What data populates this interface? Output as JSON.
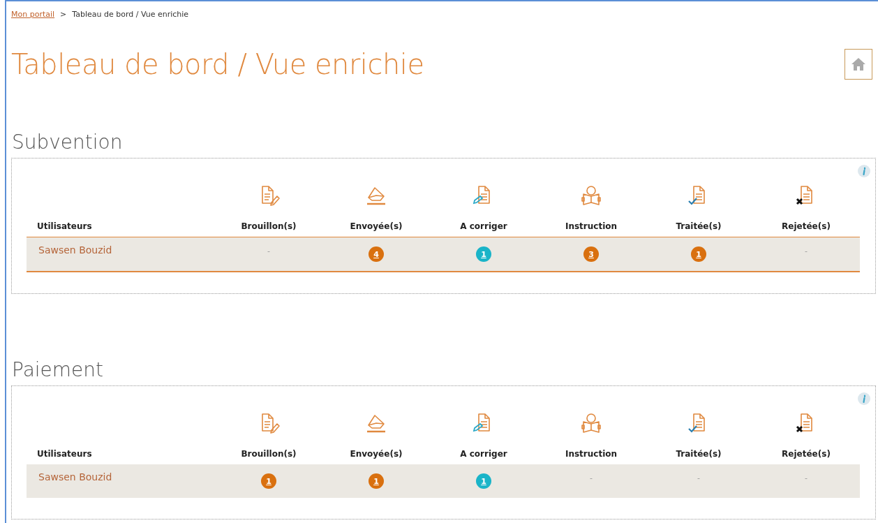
{
  "breadcrumb": {
    "link": "Mon portail",
    "separator": ">",
    "current": "Tableau de bord / Vue enrichie"
  },
  "title": "Tableau de bord / Vue enrichie",
  "sections": [
    {
      "title": "Subvention",
      "columns": [
        {
          "label": "Utilisateurs",
          "kind": "user"
        },
        {
          "label": "Brouillon(s)",
          "kind": "draft"
        },
        {
          "label": "Envoyée(s)",
          "kind": "sent"
        },
        {
          "label": "A corriger",
          "kind": "fix"
        },
        {
          "label": "Instruction",
          "kind": "reading"
        },
        {
          "label": "Traitée(s)",
          "kind": "done"
        },
        {
          "label": "Rejetée(s)",
          "kind": "rejected"
        }
      ],
      "rows": [
        {
          "outlined": true,
          "cells": [
            {
              "kind": "user",
              "value": "Sawsen Bouzid"
            },
            {
              "kind": "empty",
              "value": "-"
            },
            {
              "kind": "badge",
              "value": "4",
              "color": "#d9700f"
            },
            {
              "kind": "badge",
              "value": "1",
              "color": "#1ab4c8"
            },
            {
              "kind": "badge",
              "value": "3",
              "color": "#d9700f"
            },
            {
              "kind": "badge",
              "value": "1",
              "color": "#d9700f"
            },
            {
              "kind": "empty",
              "value": "-"
            }
          ]
        }
      ]
    },
    {
      "title": "Paiement",
      "columns": [
        {
          "label": "Utilisateurs",
          "kind": "user"
        },
        {
          "label": "Brouillon(s)",
          "kind": "draft"
        },
        {
          "label": "Envoyée(s)",
          "kind": "sent"
        },
        {
          "label": "A corriger",
          "kind": "fix"
        },
        {
          "label": "Instruction",
          "kind": "reading"
        },
        {
          "label": "Traitée(s)",
          "kind": "done"
        },
        {
          "label": "Rejetée(s)",
          "kind": "rejected"
        }
      ],
      "rows": [
        {
          "outlined": false,
          "cells": [
            {
              "kind": "user",
              "value": "Sawsen Bouzid"
            },
            {
              "kind": "badge",
              "value": "1",
              "color": "#d9700f"
            },
            {
              "kind": "badge",
              "value": "1",
              "color": "#d9700f"
            },
            {
              "kind": "badge",
              "value": "1",
              "color": "#1ab4c8"
            },
            {
              "kind": "empty",
              "value": "-"
            },
            {
              "kind": "empty",
              "value": "-"
            },
            {
              "kind": "empty",
              "value": "-"
            }
          ]
        }
      ]
    }
  ]
}
